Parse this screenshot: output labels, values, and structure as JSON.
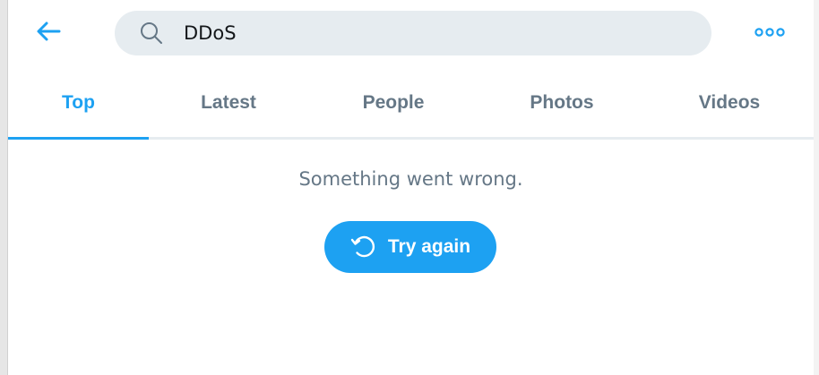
{
  "header": {
    "back_icon": "arrow-left-icon",
    "search": {
      "icon": "search-icon",
      "value": "DDoS"
    },
    "more_icon": "more-dots-icon"
  },
  "tabs": [
    {
      "label": "Top",
      "active": true
    },
    {
      "label": "Latest",
      "active": false
    },
    {
      "label": "People",
      "active": false
    },
    {
      "label": "Photos",
      "active": false
    },
    {
      "label": "Videos",
      "active": false
    }
  ],
  "content": {
    "error_message": "Something went wrong.",
    "retry_label": "Try again",
    "retry_icon": "refresh-icon"
  },
  "colors": {
    "accent": "#1da1f2",
    "muted_text": "#657786",
    "search_bg": "#e6ecf0"
  }
}
